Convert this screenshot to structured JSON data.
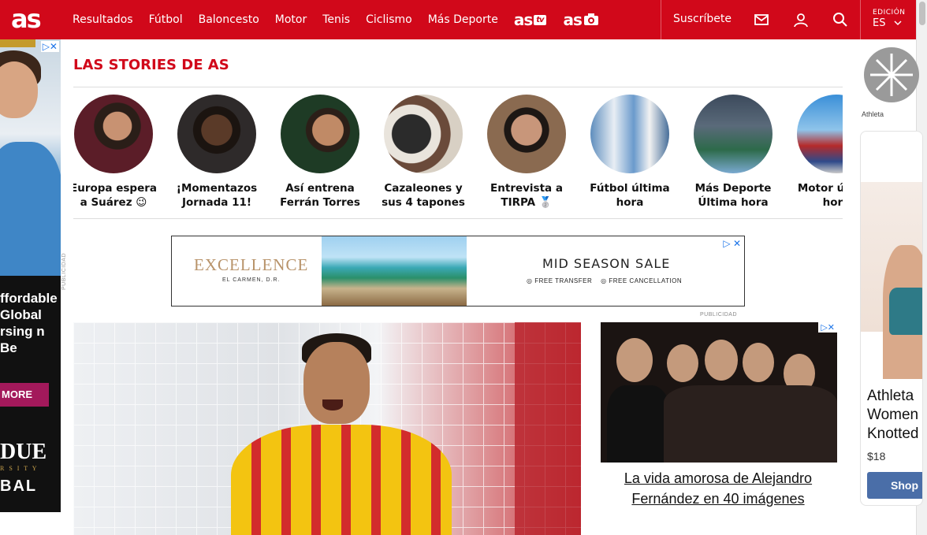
{
  "header": {
    "logo": "as",
    "nav": [
      "Resultados",
      "Fútbol",
      "Baloncesto",
      "Motor",
      "Tenis",
      "Ciclismo",
      "Más Deporte"
    ],
    "brand_tv": {
      "text": "as",
      "tag": "tv"
    },
    "brand_photo": {
      "text": "as"
    },
    "subscribe": "Suscríbete",
    "edition_label": "EDICIÓN",
    "edition_value": "ES",
    "icons": [
      "mail-icon",
      "user-icon",
      "search-icon",
      "chevron-down-icon"
    ],
    "color": "#d1081a"
  },
  "stories": {
    "title": "LAS STORIES DE AS",
    "items": [
      {
        "caption": "Europa espera a Suárez 😉"
      },
      {
        "caption": "¡Momentazos Jornada 11!"
      },
      {
        "caption": "Así entrena Ferrán Torres"
      },
      {
        "caption": "Cazaleones y sus 4 tapones"
      },
      {
        "caption": "Entrevista a TIRPA 🥈"
      },
      {
        "caption": "Fútbol última hora"
      },
      {
        "caption": "Más Deporte Última hora"
      },
      {
        "caption": "Motor última hora"
      }
    ]
  },
  "left_ad": {
    "copy": "ffordable Global rsing n Be",
    "button": "MORE",
    "brand_line1": "DUE",
    "brand_line2": "R S I T Y",
    "brand_line3": "BAL",
    "side_label": "PUBLICIDAD"
  },
  "banner_ad": {
    "brand": "EXCELLENCE",
    "brand_sub": "EL CARMEN, D.R.",
    "headline": "MID SEASON SALE",
    "perk1": "FREE TRANSFER",
    "perk2": "FREE CANCELLATION",
    "label": "PUBLICIDAD"
  },
  "right_ad": {
    "caption": "La vida amorosa de Alejandro Fernández en 40 imágenes"
  },
  "rail": {
    "label": "Athleta",
    "title": "Athleta Women Knotted",
    "price": "$18",
    "button": "Shop"
  }
}
